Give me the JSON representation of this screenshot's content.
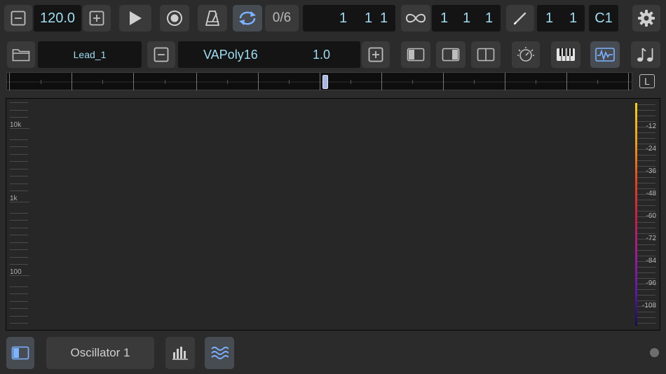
{
  "transport": {
    "tempo": "120.0",
    "pattern_count": "0/6",
    "position": [
      "1",
      "1",
      "1"
    ],
    "loop_position": [
      "1",
      "1",
      "1"
    ],
    "edit_position": [
      "1",
      "1"
    ],
    "key": "C1"
  },
  "instrument": {
    "preset_name": "Lead_1",
    "synth_name": "VAPoly16",
    "synth_version": "1.0"
  },
  "timeline": {
    "lock_label": "L"
  },
  "spectrum": {
    "freq_labels": [
      "10k",
      "1k",
      "100"
    ],
    "db_labels": [
      "-12",
      "-24",
      "-36",
      "-48",
      "-60",
      "-72",
      "-84",
      "-96",
      "-108"
    ]
  },
  "bottom": {
    "module_name": "Oscillator 1"
  },
  "colors": {
    "accent": "#9fdcf2",
    "active_icon": "#7db3ff",
    "panel": "#3a3a3a",
    "background": "#2b2b2b"
  }
}
